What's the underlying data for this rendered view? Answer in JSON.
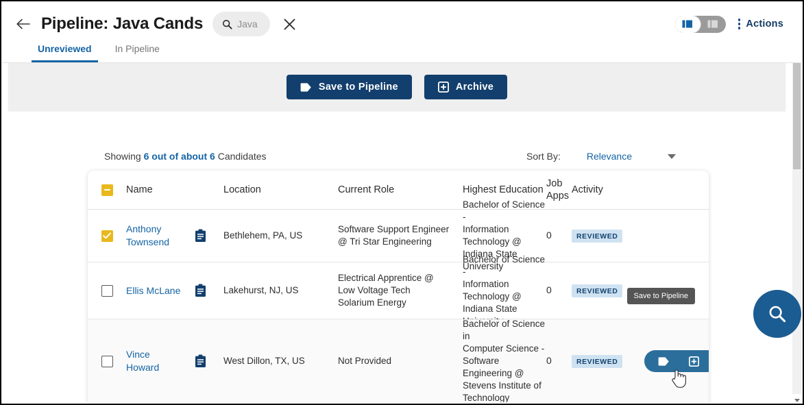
{
  "header": {
    "back_icon": "arrow-left-icon",
    "title": "Pipeline: Java Cands",
    "search_chip": {
      "icon": "search-icon",
      "text": "Java"
    },
    "close_icon": "close-icon",
    "view_toggle": {
      "left_icon": "list-view-icon",
      "right_icon": "grid-view-icon",
      "state": "left"
    },
    "actions": {
      "icon": "kebab-menu-icon",
      "label": "Actions"
    },
    "tabs": [
      {
        "label": "Unreviewed",
        "active": true
      },
      {
        "label": "In Pipeline",
        "active": false
      }
    ]
  },
  "action_bar": {
    "save_button": {
      "label": "Save to Pipeline",
      "icon": "tag-icon"
    },
    "archive_button": {
      "label": "Archive",
      "icon": "archive-box-icon"
    }
  },
  "results": {
    "showing_prefix": "Showing ",
    "showing_count": "6 out of about 6",
    "showing_suffix": " Candidates",
    "sort_by_label": "Sort By:",
    "sort_by_value": "Relevance",
    "sort_caret_icon": "chevron-down-icon"
  },
  "table": {
    "select_all_state": "indeterminate",
    "columns": {
      "name": "Name",
      "location": "Location",
      "current_role": "Current Role",
      "education": "Highest Education",
      "job_apps_line1": "Job",
      "job_apps_line2": "Apps",
      "activity": "Activity"
    },
    "rows": [
      {
        "checked": true,
        "name_line1": "Anthony",
        "name_line2": "Townsend",
        "resume_icon": "resume-document-icon",
        "location": "Bethlehem, PA, US",
        "role_line1": "Software Support Engineer",
        "role_line2": "@ Tri Star Engineering",
        "role_line3": "",
        "edu_line1": "Bachelor of Science -",
        "edu_line2": "Information Technology @",
        "edu_line3": "Indiana State University",
        "edu_line4": "",
        "edu_line5": "",
        "job_apps": "0",
        "activity": "REVIEWED"
      },
      {
        "checked": false,
        "name_line1": "Ellis McLane",
        "name_line2": "",
        "resume_icon": "resume-document-icon",
        "location": "Lakehurst, NJ, US",
        "role_line1": "Electrical Apprentice @",
        "role_line2": "Low Voltage Tech",
        "role_line3": "Solarium Energy",
        "edu_line1": "Bachelor of Science -",
        "edu_line2": "Information Technology @",
        "edu_line3": "Indiana State University",
        "edu_line4": "",
        "edu_line5": "",
        "job_apps": "0",
        "activity": "REVIEWED"
      },
      {
        "checked": false,
        "name_line1": "Vince",
        "name_line2": "Howard",
        "resume_icon": "resume-document-icon",
        "location": "West Dillon, TX, US",
        "role_line1": "Not Provided",
        "role_line2": "",
        "role_line3": "",
        "edu_line1": "Bachelor of Science in",
        "edu_line2": "Computer Science -",
        "edu_line3": "Software Engineering @",
        "edu_line4": "Stevens Institute of",
        "edu_line5": "Technology",
        "job_apps": "0",
        "activity": "REVIEWED"
      }
    ]
  },
  "hover_overlay": {
    "tooltip": "Save to Pipeline",
    "save_icon": "tag-icon",
    "archive_icon": "archive-box-icon",
    "cursor_icon": "pointer-hand-cursor-icon"
  },
  "fab": {
    "icon": "search-icon"
  },
  "colors": {
    "navy": "#123f6d",
    "link_blue": "#1464a5",
    "gold": "#e8b81c",
    "hover_blue": "#2b6e9b",
    "badge_bg": "#cfe2f2",
    "fab_blue": "#1b5c92"
  }
}
